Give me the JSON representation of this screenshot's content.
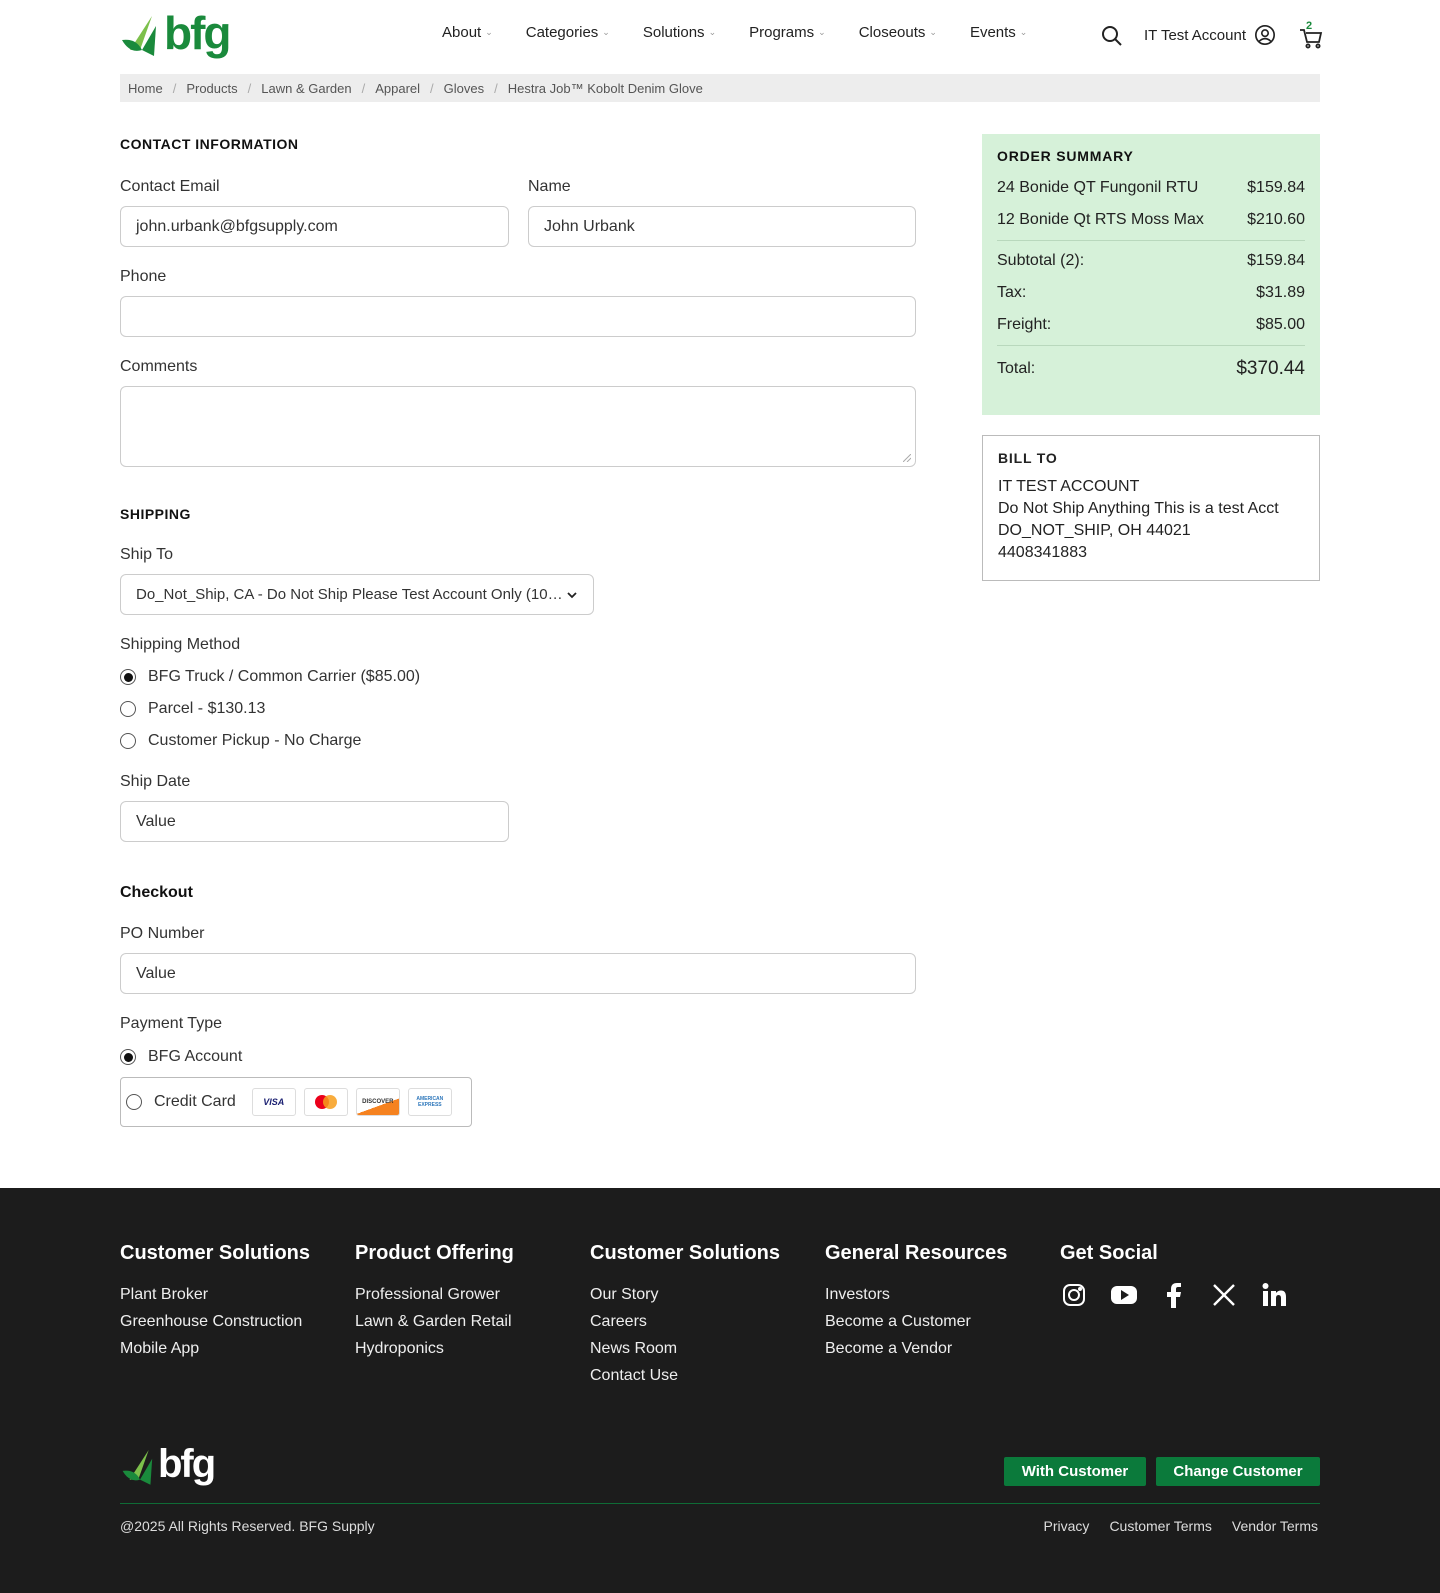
{
  "header": {
    "logo_text": "bfg",
    "nav": [
      "About",
      "Categories",
      "Solutions",
      "Programs",
      "Closeouts",
      "Events"
    ],
    "account_label": "IT Test Account",
    "cart_count": "2"
  },
  "breadcrumb": [
    "Home",
    "Products",
    "Lawn & Garden",
    "Apparel",
    "Gloves",
    "Hestra Job™ Kobolt Denim Glove"
  ],
  "contact": {
    "title": "CONTACT INFORMATION",
    "email_label": "Contact Email",
    "email_value": "john.urbank@bfgsupply.com",
    "name_label": "Name",
    "name_value": "John Urbank",
    "phone_label": "Phone",
    "comments_label": "Comments"
  },
  "shipping": {
    "title": "SHIPPING",
    "ship_to_label": "Ship To",
    "ship_to_value": "Do_Not_Ship, CA - Do Not Ship Please Test Account Only (10…",
    "method_label": "Shipping Method",
    "methods": [
      "BFG Truck / Common Carrier ($85.00)",
      "Parcel - $130.13",
      "Customer Pickup - No Charge"
    ],
    "ship_date_label": "Ship Date",
    "ship_date_value": "Value"
  },
  "checkout": {
    "title": "Checkout",
    "po_label": "PO Number",
    "po_value": "Value",
    "payment_label": "Payment Type",
    "payment_account": "BFG Account",
    "payment_card": "Credit Card",
    "cards": [
      "VISA",
      "MC",
      "DISCOVER",
      "AMERICAN EXPRESS"
    ]
  },
  "summary": {
    "title": "ORDER SUMMARY",
    "items": [
      {
        "name": "24 Bonide QT Fungonil RTU",
        "price": "$159.84"
      },
      {
        "name": "12 Bonide Qt RTS Moss Max",
        "price": "$210.60"
      }
    ],
    "subtotal_label": "Subtotal (2):",
    "subtotal": "$159.84",
    "tax_label": "Tax:",
    "tax": "$31.89",
    "freight_label": "Freight:",
    "freight": "$85.00",
    "total_label": "Total:",
    "total": "$370.44"
  },
  "billto": {
    "title": "BILL TO",
    "lines": [
      "IT TEST ACCOUNT",
      "Do Not Ship Anything This is a test Acct",
      "DO_NOT_SHIP, OH 44021",
      "4408341883"
    ]
  },
  "footer": {
    "cols": [
      {
        "title": "Customer Solutions",
        "links": [
          "Plant Broker",
          "Greenhouse Construction",
          "Mobile App"
        ]
      },
      {
        "title": "Product Offering",
        "links": [
          "Professional Grower",
          "Lawn & Garden Retail",
          "Hydroponics"
        ]
      },
      {
        "title": "Customer Solutions",
        "links": [
          "Our Story",
          "Careers",
          "News Room",
          "Contact Use"
        ]
      },
      {
        "title": "General Resources",
        "links": [
          "Investors",
          "Become a Customer",
          "Become a Vendor"
        ]
      }
    ],
    "social_title": "Get Social",
    "btn_with": "With Customer",
    "btn_change": "Change Customer",
    "copyright": "@2025 All Rights Reserved. BFG Supply",
    "links": [
      "Privacy",
      "Customer Terms",
      "Vendor Terms"
    ]
  },
  "colors": {
    "brand_green": "#1a8a3c",
    "summary_bg": "#d6f1d9",
    "footer_bg": "#1c1c1c",
    "button_green": "#0b7a3b"
  }
}
